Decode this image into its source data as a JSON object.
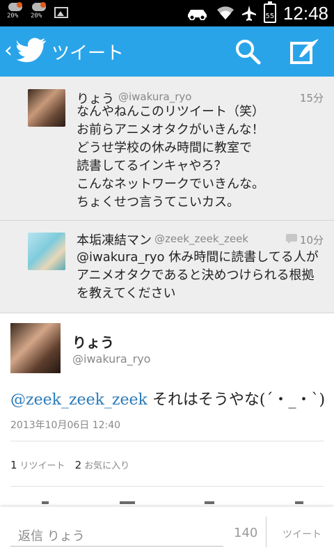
{
  "status_bar": {
    "badges": [
      "20%",
      "20%"
    ],
    "battery_level": "55",
    "time": "12:48"
  },
  "app_bar": {
    "title": "ツイート",
    "accent": "#2aa4e9"
  },
  "context_tweets": [
    {
      "name": "りょう",
      "handle": "@iwakura_ryo",
      "time": "15分",
      "text": "なんやねんこのリツイート（笑）\nお前らアニメオタクがいきんな！\nどうせ学校の休み時間に教室で\n読書してるインキャやろ？\nこんなネットワークでいきんな。\nちょくせつ言うてこいカス。"
    },
    {
      "name": "本垢凍結マン",
      "handle": "@zeek_zeek_zeek",
      "time": "10分",
      "text": "@iwakura_ryo 休み時間に読書してる人がアニメオタクであると決めつけられる根拠を教えてください"
    }
  ],
  "main_tweet": {
    "name": "りょう",
    "handle": "@iwakura_ryo",
    "mention": "@zeek_zeek_zeek",
    "text": " それはそうやな(´・_・`)",
    "date": "2013年10月06日 12:40",
    "retweet_count": "1",
    "retweet_label": "リツイート",
    "favorite_count": "2",
    "favorite_label": "お気に入り"
  },
  "reply_bar": {
    "placeholder": "返信 りょう",
    "char_count": "140",
    "send_label": "ツイート"
  }
}
